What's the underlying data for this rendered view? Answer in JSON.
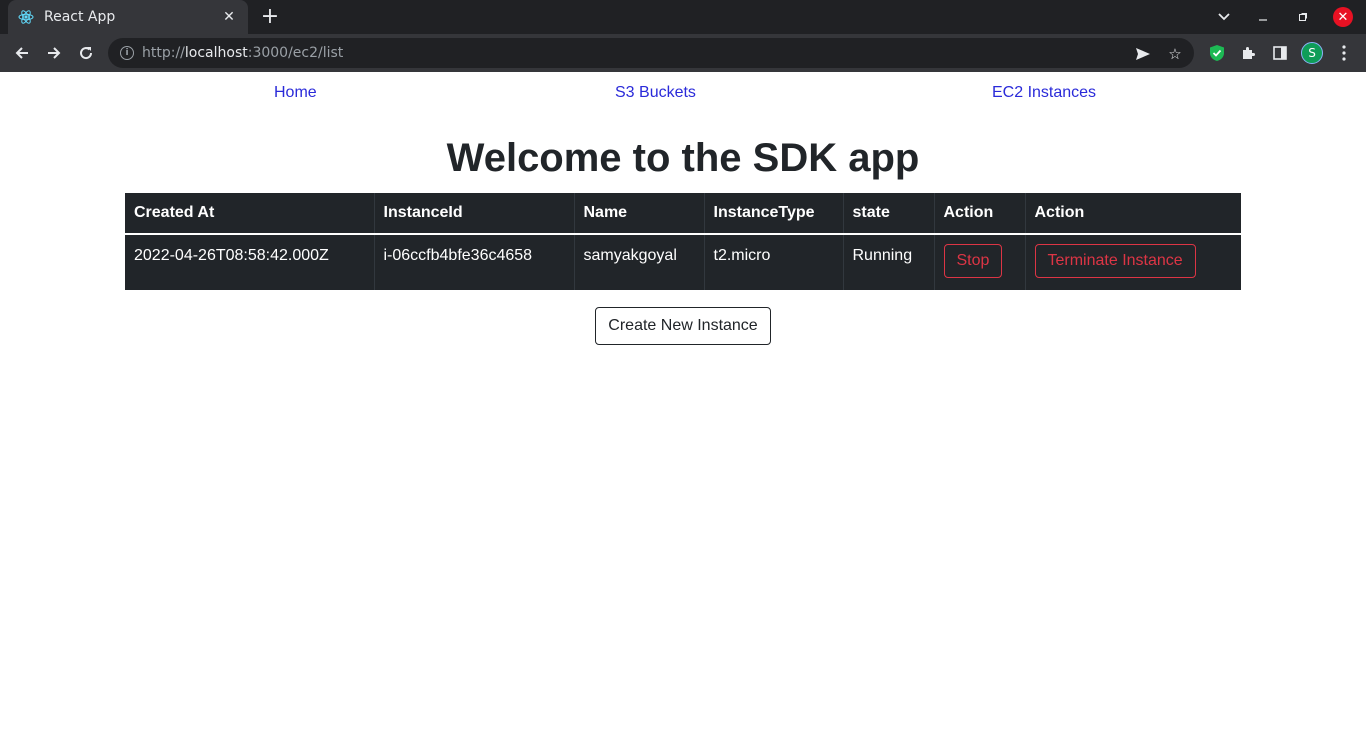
{
  "browser": {
    "tab_title": "React App",
    "new_tab_icon": "plus-icon",
    "url_protocol": "http://",
    "url_host": "localhost",
    "url_rest": ":3000/ec2/list",
    "profile_initial": "S"
  },
  "nav": {
    "home": "Home",
    "s3": "S3 Buckets",
    "ec2": "EC2 Instances"
  },
  "title": "Welcome to the SDK app",
  "table": {
    "headers": [
      "Created At",
      "InstanceId",
      "Name",
      "InstanceType",
      "state",
      "Action",
      "Action"
    ],
    "rows": [
      {
        "created_at": "2022-04-26T08:58:42.000Z",
        "instance_id": "i-06ccfb4bfe36c4658",
        "name": "samyakgoyal",
        "instance_type": "t2.micro",
        "state": "Running",
        "action_stop": "Stop",
        "action_terminate": "Terminate Instance"
      }
    ]
  },
  "create_button": "Create New Instance",
  "colors": {
    "table_bg": "#212529",
    "danger": "#dc3545",
    "link": "#2a2ad9"
  }
}
